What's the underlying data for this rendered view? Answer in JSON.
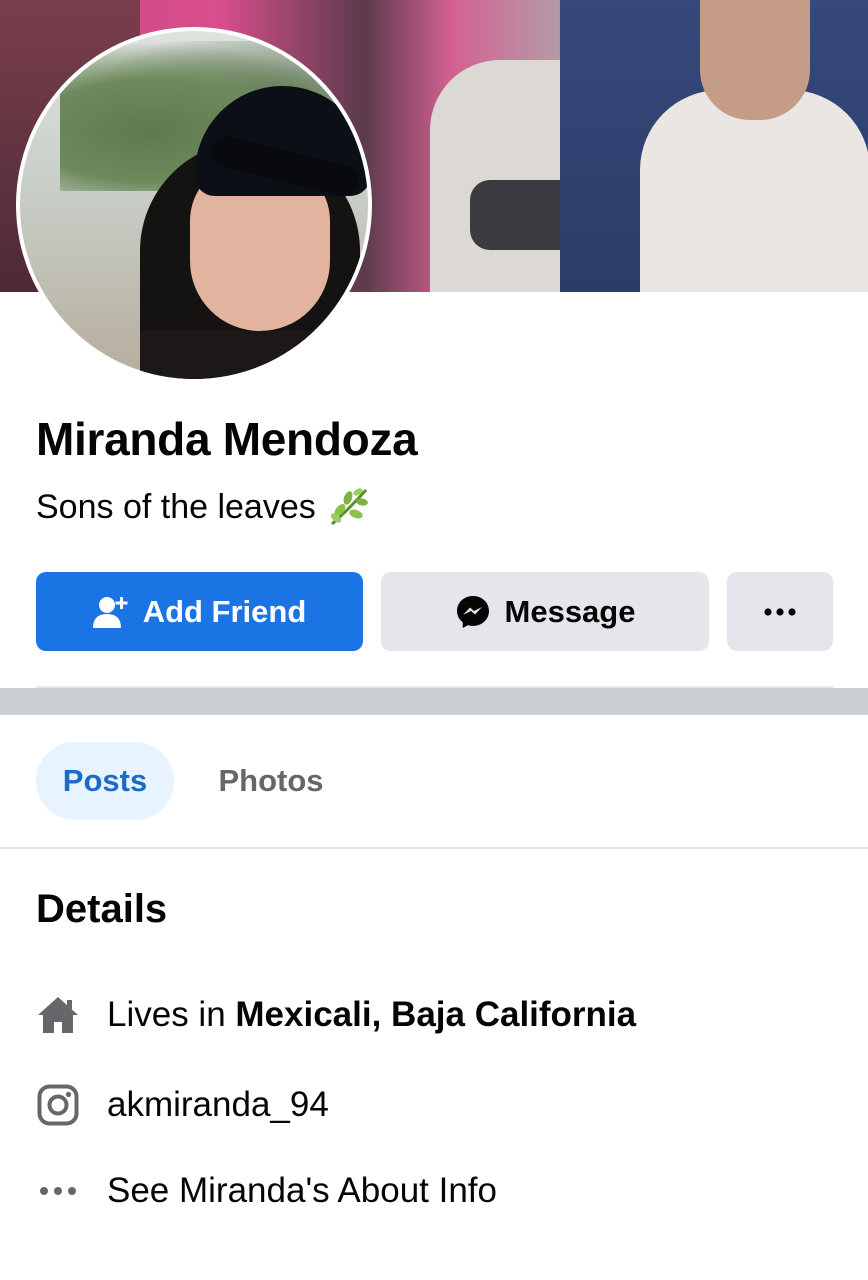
{
  "profile": {
    "name": "Miranda Mendoza",
    "bio": "Sons of the leaves",
    "bio_icon": "herb-leaf-icon"
  },
  "actions": {
    "add_friend_label": "Add Friend",
    "message_label": "Message",
    "more_label": "•••"
  },
  "tabs": [
    {
      "label": "Posts",
      "active": true
    },
    {
      "label": "Photos",
      "active": false
    }
  ],
  "details": {
    "title": "Details",
    "lives_prefix": "Lives in",
    "lives_location": "Mexicali, Baja California",
    "instagram": "akmiranda_94",
    "about_link": "See Miranda's About Info"
  },
  "colors": {
    "accent": "#1b74e4",
    "tab_active_bg": "#e7f3ff",
    "tab_active_text": "#1b6ac9",
    "button_gray": "#e4e6eb",
    "icon_gray": "#65676b"
  }
}
